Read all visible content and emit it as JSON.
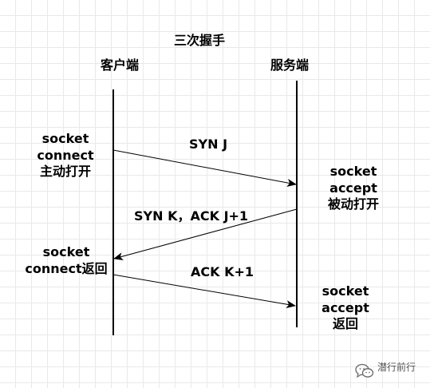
{
  "title": "三次握手",
  "client_label": "客户端",
  "server_label": "服务端",
  "client_notes": {
    "first": [
      "socket",
      "connect",
      "主动打开"
    ],
    "second": [
      "socket",
      "connect返回"
    ]
  },
  "server_notes": {
    "first": [
      "socket",
      "accept",
      "被动打开"
    ],
    "second": [
      "socket",
      "accept",
      "返回"
    ]
  },
  "messages": [
    {
      "label": "SYN J",
      "direction": "client-to-server"
    },
    {
      "label": "SYN K，ACK J+1",
      "direction": "server-to-client"
    },
    {
      "label": "ACK K+1",
      "direction": "client-to-server"
    }
  ],
  "watermark": {
    "name": "潜行前行",
    "sub": " ",
    "icon": "wechat-icon"
  },
  "colors": {
    "line": "#000000",
    "grid": "#e9e9e9"
  }
}
